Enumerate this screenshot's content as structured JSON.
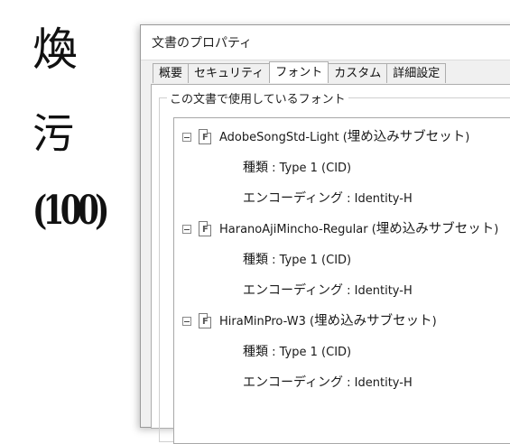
{
  "background": {
    "glyphs": [
      "煥",
      "污",
      "(100)"
    ]
  },
  "dialog": {
    "title": "文書のプロパティ",
    "tabs": [
      {
        "label": "概要",
        "active": false
      },
      {
        "label": "セキュリティ",
        "active": false
      },
      {
        "label": "フォント",
        "active": true
      },
      {
        "label": "カスタム",
        "active": false
      },
      {
        "label": "詳細設定",
        "active": false
      }
    ],
    "group_label": "この文書で使用しているフォント",
    "fonts": [
      {
        "name": "AdobeSongStd-Light",
        "embed_open": " (",
        "embed_text": "埋め込みサブセット",
        "embed_close": ")",
        "type_label": "種類",
        "type_value": " : Type 1 (CID)",
        "encoding_label": "エンコーディング",
        "encoding_value": " : Identity-H"
      },
      {
        "name": "HaranoAjiMincho-Regular",
        "embed_open": " (",
        "embed_text": "埋め込みサブセット",
        "embed_close": ")",
        "type_label": "種類",
        "type_value": " : Type 1 (CID)",
        "encoding_label": "エンコーディング",
        "encoding_value": " : Identity-H"
      },
      {
        "name": "HiraMinPro-W3",
        "embed_open": " (",
        "embed_text": "埋め込みサブセット",
        "embed_close": ")",
        "type_label": "種類",
        "type_value": " : Type 1 (CID)",
        "encoding_label": "エンコーディング",
        "encoding_value": " : Identity-H"
      }
    ]
  }
}
